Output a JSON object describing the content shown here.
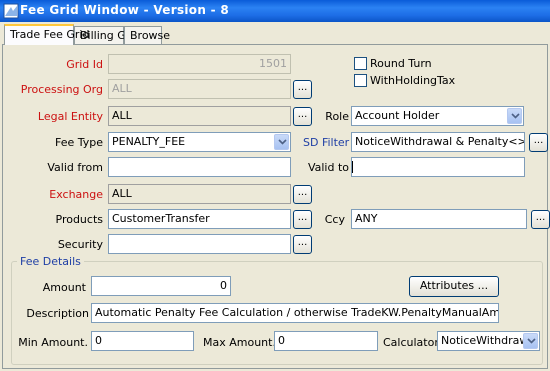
{
  "window": {
    "title": "Fee Grid Window - Version - 8"
  },
  "tabs": [
    {
      "label": "Trade Fee Grid",
      "active": true
    },
    {
      "label": "Billing Grid",
      "active": false
    },
    {
      "label": "Browse",
      "active": false
    }
  ],
  "form": {
    "grid_id": {
      "label": "Grid Id",
      "value": "1501"
    },
    "processing_org": {
      "label": "Processing Org",
      "value": "ALL"
    },
    "legal_entity": {
      "label": "Legal Entity",
      "value": "ALL"
    },
    "fee_type": {
      "label": "Fee Type",
      "value": "PENALTY_FEE"
    },
    "valid_from": {
      "label": "Valid from",
      "value": ""
    },
    "exchange": {
      "label": "Exchange",
      "value": "ALL"
    },
    "products": {
      "label": "Products",
      "value": "CustomerTransfer"
    },
    "security": {
      "label": "Security",
      "value": ""
    },
    "round_turn": {
      "label": "Round Turn",
      "checked": false
    },
    "withholding_tax": {
      "label": "WithHoldingTax",
      "checked": false
    },
    "role": {
      "label": "Role",
      "value": "Account Holder"
    },
    "sd_filter": {
      "label": "SD Filter",
      "value": "NoticeWithdrawal & Penalty<>Zero"
    },
    "valid_to": {
      "label": "Valid to",
      "value": ""
    },
    "ccy": {
      "label": "Ccy",
      "value": "ANY"
    },
    "ellipsis": "..."
  },
  "fee_details": {
    "legend": "Fee Details",
    "amount": {
      "label": "Amount",
      "value": "0"
    },
    "attributes_button": "Attributes ...",
    "description": {
      "label": "Description",
      "value": "Automatic Penalty Fee Calculation / otherwise TradeKW.PenaltyManualAmount"
    },
    "min_amount": {
      "label": "Min Amount.",
      "value": "0"
    },
    "max_amount": {
      "label": "Max Amount.",
      "value": "0"
    },
    "calculator": {
      "label": "Calculator",
      "value": "NoticeWithdrawa..."
    }
  },
  "colors": {
    "title_bar": "#2B82F3",
    "required_label": "#CC1111",
    "link_label": "#1F3FA5",
    "active_tab_accent": "#FFC83C"
  }
}
